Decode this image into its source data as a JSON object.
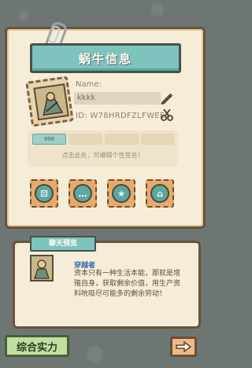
{
  "profile": {
    "title": "蜗牛信息",
    "name_label": "Name:",
    "name_value": "kkkk",
    "id_text": "ID: W78HRDFZLFWEE1",
    "signature_tab_value": "996",
    "signature_hint": "点击此处，可编辑个性签名！"
  },
  "action_icons": [
    "dice-icon",
    "chat-bubble-icon",
    "badge-icon",
    "shop-icon"
  ],
  "chat_preview": {
    "tab_label": "聊天预览",
    "sender": "穿越者",
    "message": "资本只有一种生活本能，那就是增殖自身，获取剩余价值，用生产资料吮吸尽可能多的剩余劳动！"
  },
  "bottom": {
    "power_button": "综合实力",
    "next_icon": "arrow-right-icon"
  }
}
